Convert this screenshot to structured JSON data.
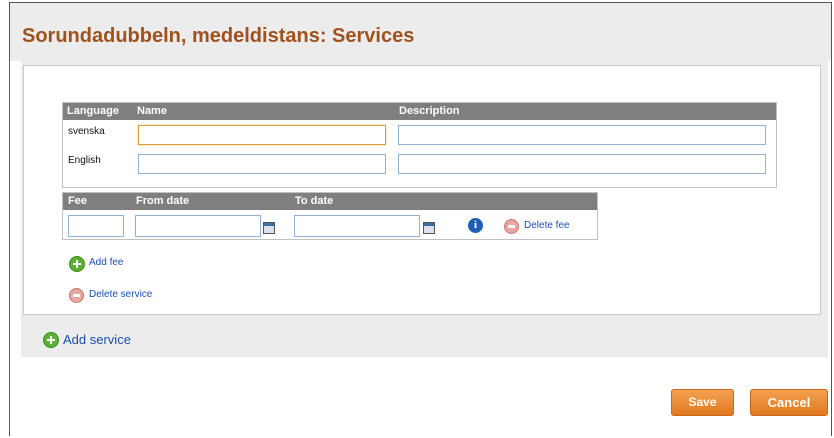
{
  "title": "Sorundadubbeln, medeldistans: Services",
  "service_table": {
    "headers": {
      "language": "Language",
      "name": "Name",
      "description": "Description"
    },
    "rows": [
      {
        "language": "svenska",
        "name": "",
        "description": ""
      },
      {
        "language": "English",
        "name": "",
        "description": ""
      }
    ]
  },
  "fee_table": {
    "headers": {
      "fee": "Fee",
      "from_date": "From date",
      "to_date": "To date"
    },
    "row": {
      "fee": "",
      "from_date": "",
      "to_date": ""
    },
    "delete_fee": "Delete fee"
  },
  "add_fee": "Add fee",
  "delete_service": "Delete service",
  "add_service": "Add service",
  "buttons": {
    "save": "Save",
    "cancel": "Cancel"
  },
  "colors": {
    "accent": "#e07820",
    "title": "#a0521e",
    "link": "#1a4fb0",
    "header": "#7f7f7f"
  },
  "icons": [
    "calendar-icon",
    "info-icon",
    "minus-circle-icon",
    "plus-circle-icon"
  ]
}
